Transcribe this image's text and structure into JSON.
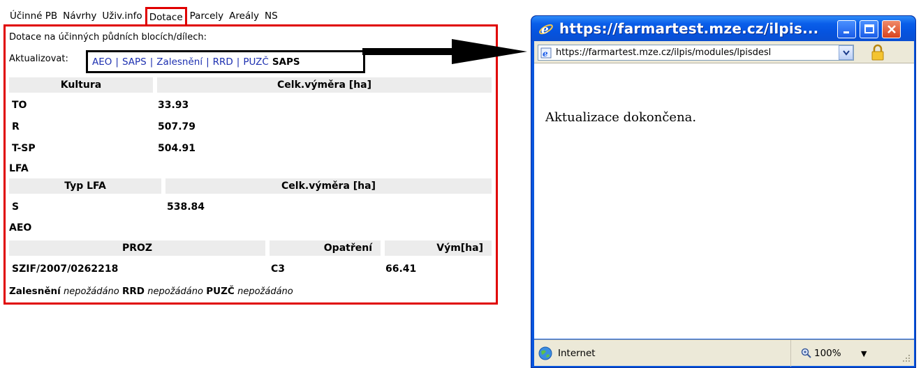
{
  "tabs": [
    "Účinné PB",
    "Návrhy",
    "Uživ.info",
    "Dotace",
    "Parcely",
    "Areály",
    "NS"
  ],
  "active_tab": "Dotace",
  "panel": {
    "intro": "Dotace na účinných půdních blocích/dílech:",
    "update_label": "Aktualizovat:",
    "update_links": [
      "AEO",
      "SAPS",
      "Zalesnění",
      "RRD",
      "PUZČ"
    ],
    "update_current": "SAPS",
    "saps": {
      "headers": [
        "Kultura",
        "Celk.výměra [ha]"
      ],
      "rows": [
        [
          "TO",
          "33.93"
        ],
        [
          "R",
          "507.79"
        ],
        [
          "T-SP",
          "504.91"
        ]
      ]
    },
    "lfa": {
      "title": "LFA",
      "headers": [
        "Typ LFA",
        "Celk.výměra [ha]"
      ],
      "rows": [
        [
          "S",
          "538.84"
        ]
      ]
    },
    "aeo": {
      "title": "AEO",
      "headers": [
        "PROZ",
        "Opatření",
        "Vým[ha]"
      ],
      "rows": [
        [
          "SZIF/2007/0262218",
          "C3",
          "66.41"
        ]
      ]
    },
    "footer": {
      "zalesneni_label": "Zalesnění",
      "zalesneni_value": "nepožádáno",
      "rrd_label": "RRD",
      "rrd_value": "nepožádáno",
      "puzc_label": "PUZČ",
      "puzc_value": "nepožádáno"
    }
  },
  "popup": {
    "title": "https://farmartest.mze.cz/ilpis...",
    "address": "https://farmartest.mze.cz/ilpis/modules/lpisdesl",
    "message": "Aktualizace dokončena.",
    "status_zone": "Internet",
    "zoom": "100%"
  },
  "colors": {
    "highlight_red": "#e00000",
    "link_blue": "#1c2fb0",
    "titlebar_blue": "#0a5fea",
    "header_gray": "#ececec"
  },
  "icons": [
    "ie-logo-icon",
    "minimize-icon",
    "maximize-icon",
    "close-icon",
    "page-icon",
    "chevron-down-icon",
    "lock-icon",
    "globe-icon",
    "zoom-icon",
    "resize-grip-icon",
    "arrow-icon"
  ]
}
